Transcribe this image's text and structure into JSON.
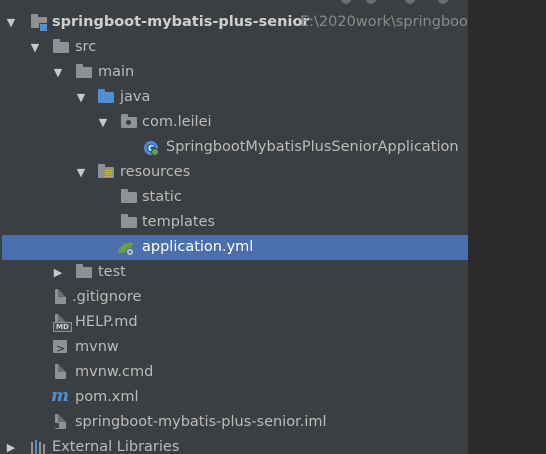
{
  "tree": {
    "root": {
      "name": "springboot-mybatis-plus-senior",
      "path": "E:\\2020work\\springboo"
    },
    "items": [
      {
        "label": "src"
      },
      {
        "label": "main"
      },
      {
        "label": "java"
      },
      {
        "label": "com.leilei"
      },
      {
        "label": "SpringbootMybatisPlusSeniorApplication"
      },
      {
        "label": "resources"
      },
      {
        "label": "static"
      },
      {
        "label": "templates"
      },
      {
        "label": "application.yml"
      },
      {
        "label": "test"
      },
      {
        "label": ".gitignore"
      },
      {
        "label": "HELP.md"
      },
      {
        "label": "mvnw"
      },
      {
        "label": "mvnw.cmd"
      },
      {
        "label": "pom.xml"
      },
      {
        "label": "springboot-mybatis-plus-senior.iml"
      },
      {
        "label": "External Libraries"
      }
    ],
    "selected": "application.yml"
  },
  "colors": {
    "panel_bg": "#3c3f41",
    "selection": "#4b6eaf",
    "folder_gray": "#8f9193",
    "folder_blue": "#4d8fd1",
    "spring_green": "#6a9f3e"
  },
  "icons": {
    "expanded": "triangle-down",
    "collapsed": "triangle-right"
  }
}
